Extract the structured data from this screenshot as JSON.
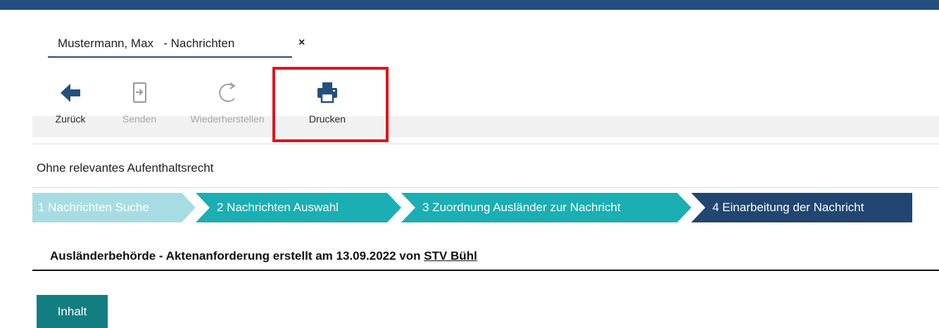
{
  "tab": {
    "title": "Mustermann, Max   - Nachrichten",
    "close": "×"
  },
  "toolbar": {
    "back": {
      "label": "Zurück",
      "icon": "arrow-left-icon",
      "enabled": true
    },
    "send": {
      "label": "Senden",
      "icon": "send-document-icon",
      "enabled": false
    },
    "restore": {
      "label": "Wiederherstellen",
      "icon": "refresh-icon",
      "enabled": false
    },
    "print": {
      "label": "Drucken",
      "icon": "printer-icon",
      "enabled": true,
      "highlighted": true
    }
  },
  "status": {
    "text": "Ohne relevantes Aufenthaltsrecht"
  },
  "steps": [
    {
      "label": "1  Nachrichten Suche",
      "state": "done",
      "color": "#a7dde2"
    },
    {
      "label": "2  Nachrichten Auswahl",
      "state": "done",
      "color": "#1baeb2"
    },
    {
      "label": "3  Zuordnung Ausländer zur Nachricht",
      "state": "done",
      "color": "#1baeb2"
    },
    {
      "label": "4  Einarbeitung der Nachricht",
      "state": "active",
      "color": "#214672"
    }
  ],
  "heading": {
    "prefix": "Ausländerbehörde - Aktenanforderung erstellt am 13.09.2022 von ",
    "link": "STV Bühl"
  },
  "content_button": {
    "label": "Inhalt"
  },
  "colors": {
    "topbar": "#24507f",
    "highlight": "#e0141c",
    "primary_button": "#137e82"
  }
}
